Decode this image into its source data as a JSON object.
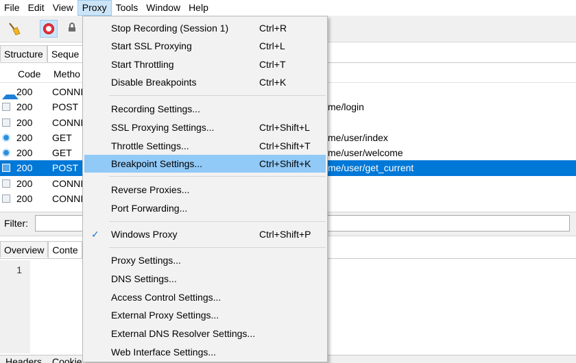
{
  "menubar": {
    "items": [
      {
        "label": "File"
      },
      {
        "label": "Edit"
      },
      {
        "label": "View"
      },
      {
        "label": "Proxy",
        "active": true
      },
      {
        "label": "Tools"
      },
      {
        "label": "Window"
      },
      {
        "label": "Help"
      }
    ]
  },
  "toolbar": {
    "icons": [
      "broom-icon",
      "record-icon",
      "lock-icon"
    ]
  },
  "upper_tabs": [
    {
      "label": "Structure"
    },
    {
      "label": "Seque",
      "selected": true
    }
  ],
  "table": {
    "columns": [
      "Code",
      "Metho"
    ],
    "rows": [
      {
        "icon": "upload-arrow-icon",
        "code": "200",
        "method": "CONNI",
        "path": ""
      },
      {
        "icon": "json-doc-icon",
        "code": "200",
        "method": "POST",
        "path": "me/login"
      },
      {
        "icon": "document-icon",
        "code": "200",
        "method": "CONNI",
        "path": ""
      },
      {
        "icon": "html-circle-icon",
        "code": "200",
        "method": "GET",
        "path": "me/user/index"
      },
      {
        "icon": "html-circle-icon",
        "code": "200",
        "method": "GET",
        "path": "me/user/welcome"
      },
      {
        "icon": "json-doc-icon",
        "code": "200",
        "method": "POST",
        "path": "me/user/get_current",
        "selected": true
      },
      {
        "icon": "document-icon",
        "code": "200",
        "method": "CONNI",
        "path": ""
      },
      {
        "icon": "document-icon",
        "code": "200",
        "method": "CONNI",
        "path": ""
      }
    ]
  },
  "filter": {
    "label": "Filter:",
    "value": ""
  },
  "lower_tabs": [
    {
      "label": "Overview"
    },
    {
      "label": "Conte",
      "selected": true
    }
  ],
  "editor": {
    "line_number": "1"
  },
  "bottom_tabs": [
    "Headers",
    "Cookie"
  ],
  "proxy_menu": {
    "groups": [
      [
        {
          "label": "Stop Recording (Session 1)",
          "shortcut": "Ctrl+R"
        },
        {
          "label": "Start SSL Proxying",
          "shortcut": "Ctrl+L"
        },
        {
          "label": "Start Throttling",
          "shortcut": "Ctrl+T"
        },
        {
          "label": "Disable Breakpoints",
          "shortcut": "Ctrl+K"
        }
      ],
      [
        {
          "label": "Recording Settings...",
          "shortcut": ""
        },
        {
          "label": "SSL Proxying Settings...",
          "shortcut": "Ctrl+Shift+L"
        },
        {
          "label": "Throttle Settings...",
          "shortcut": "Ctrl+Shift+T"
        },
        {
          "label": "Breakpoint Settings...",
          "shortcut": "Ctrl+Shift+K",
          "highlighted": true
        }
      ],
      [
        {
          "label": "Reverse Proxies...",
          "shortcut": ""
        },
        {
          "label": "Port Forwarding...",
          "shortcut": ""
        }
      ],
      [
        {
          "label": "Windows Proxy",
          "shortcut": "Ctrl+Shift+P",
          "checked": true
        }
      ],
      [
        {
          "label": "Proxy Settings...",
          "shortcut": ""
        },
        {
          "label": "DNS Settings...",
          "shortcut": ""
        },
        {
          "label": "Access Control Settings...",
          "shortcut": ""
        },
        {
          "label": "External Proxy Settings...",
          "shortcut": ""
        },
        {
          "label": "External DNS Resolver Settings...",
          "shortcut": ""
        },
        {
          "label": "Web Interface Settings...",
          "shortcut": ""
        }
      ]
    ],
    "check_glyph": "✓"
  },
  "colors": {
    "selection": "#0078d7",
    "menu_highlight": "#91c9f7",
    "menu_bg": "#f2f2f2"
  }
}
